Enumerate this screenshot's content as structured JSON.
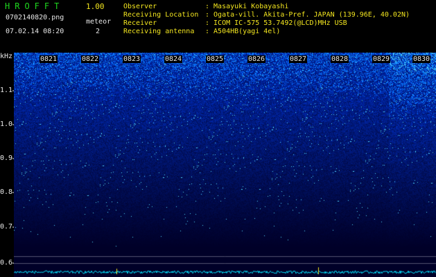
{
  "header": {
    "app_title": "HROFFT",
    "version": "1.00",
    "filename": "0702140820.png",
    "datetime": "07.02.14 08:20",
    "meteor_label": "meteor",
    "meteor_count": "2"
  },
  "info": [
    {
      "label": "Observer",
      "value": ": Masayuki Kobayashi"
    },
    {
      "label": "Receiving Location",
      "value": ": Ogata-vill. Akita-Pref. JAPAN (139.96E, 40.02N)"
    },
    {
      "label": "Receiver",
      "value": ": ICOM IC-575 53.7492(@LCD)MHz USB"
    },
    {
      "label": "Receiving antenna",
      "value": ": A504HB(yagi 4el)"
    }
  ],
  "axis": {
    "unit": "kHz",
    "freq_labels": [
      "1.1",
      "1.0",
      "0.9",
      "0.8",
      "0.7",
      "0.6"
    ],
    "time_labels": [
      "0821",
      "0822",
      "0823",
      "0824",
      "0825",
      "0826",
      "0827",
      "0828",
      "0829",
      "0830"
    ]
  },
  "colors": {
    "header_text_green": "#1fd81f",
    "header_text_yellow": "#f2e51f",
    "background": "#000000",
    "noise_low": "#00005a",
    "noise_high": "#00c8ff",
    "spectrum_trace": "#00e5ff"
  }
}
